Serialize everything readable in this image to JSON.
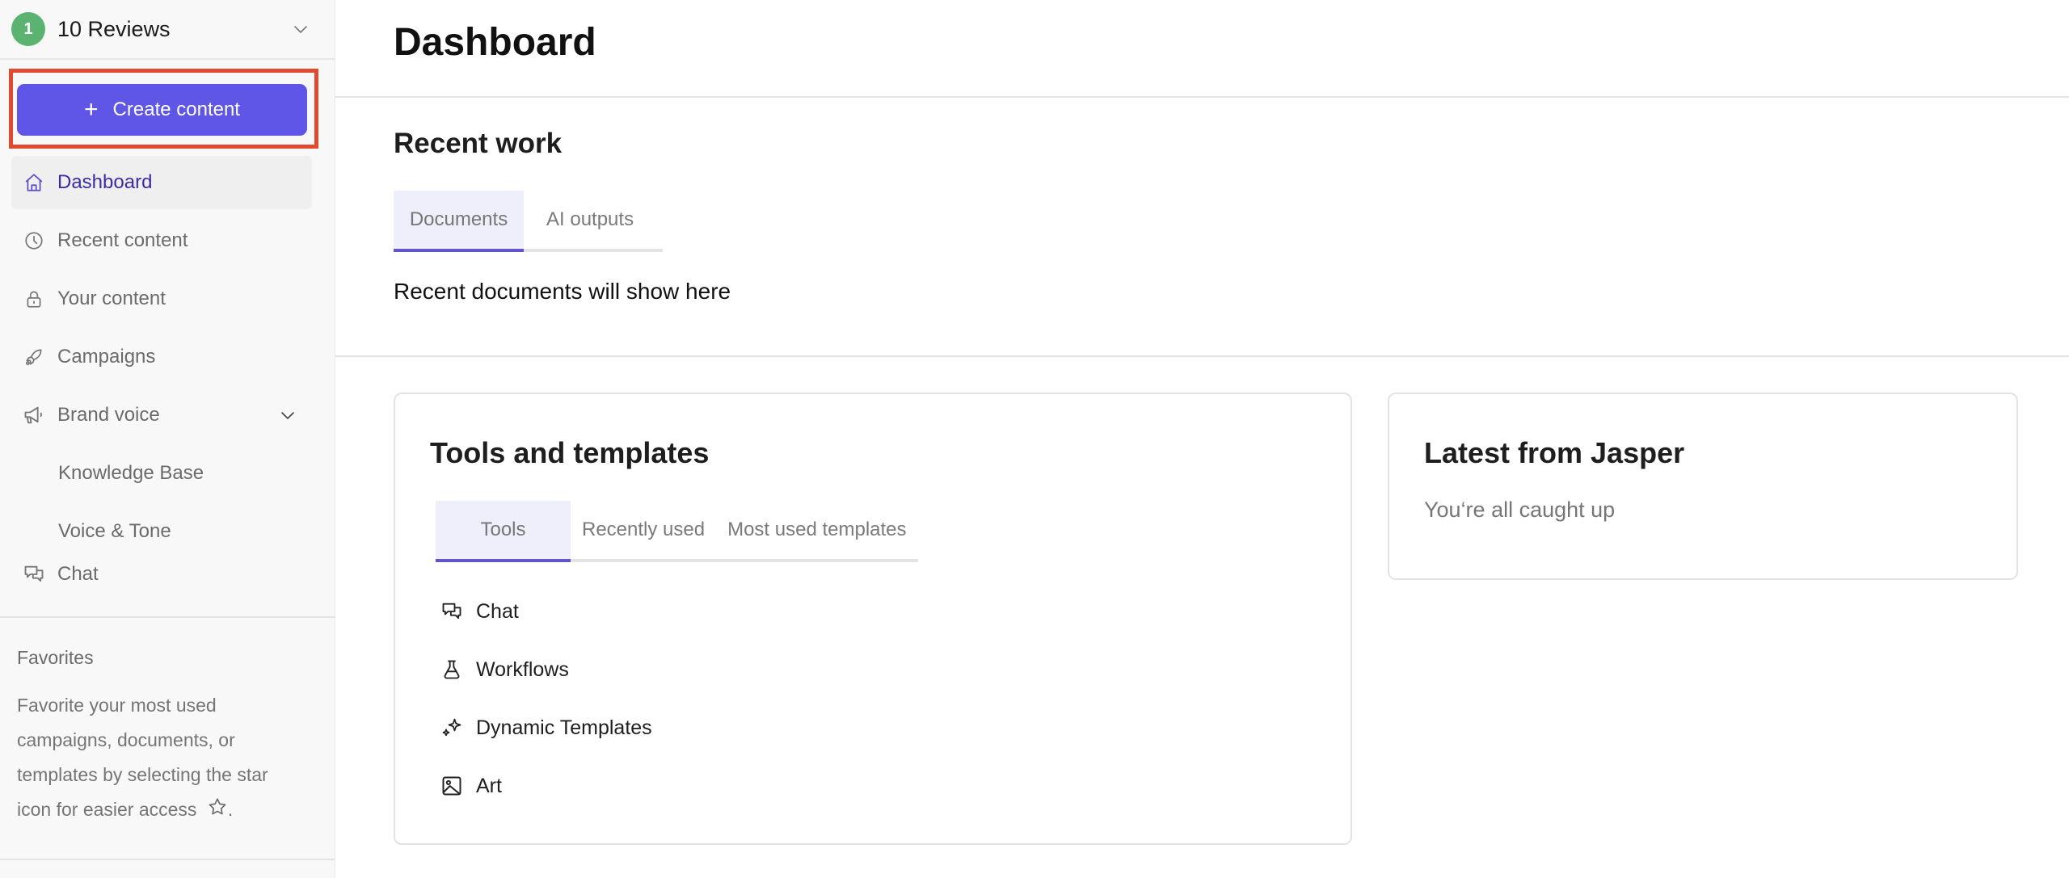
{
  "workspace": {
    "badge": "1",
    "name": "10 Reviews",
    "badge_color": "#5cb271"
  },
  "sidebar": {
    "create_button": {
      "label": "Create content",
      "icon": "plus-icon",
      "color": "#5f55e6"
    },
    "items": [
      {
        "label": "Dashboard",
        "icon": "home-icon",
        "active": true
      },
      {
        "label": "Recent content",
        "icon": "clock-icon"
      },
      {
        "label": "Your content",
        "icon": "lock-icon"
      },
      {
        "label": "Campaigns",
        "icon": "rocket-icon"
      },
      {
        "label": "Brand voice",
        "icon": "megaphone-icon",
        "expandable": true,
        "expanded": true
      },
      {
        "label": "Knowledge Base",
        "sub": true
      },
      {
        "label": "Voice & Tone",
        "sub": true
      },
      {
        "label": "Chat",
        "icon": "chat-icon"
      }
    ],
    "favorites": {
      "title": "Favorites",
      "text": "Favorite your most used campaigns, documents, or templates by selecting the star icon for easier access",
      "suffix": "."
    }
  },
  "main": {
    "title": "Dashboard",
    "recent_work": {
      "title": "Recent work",
      "tabs": [
        {
          "label": "Documents",
          "active": true
        },
        {
          "label": "AI outputs",
          "active": false
        }
      ],
      "empty_message": "Recent documents will show here"
    },
    "tools_templates": {
      "title": "Tools and templates",
      "tabs": [
        {
          "label": "Tools",
          "active": true
        },
        {
          "label": "Recently used",
          "active": false
        },
        {
          "label": "Most used templates",
          "active": false
        }
      ],
      "tools": [
        {
          "label": "Chat",
          "icon": "chat-icon"
        },
        {
          "label": "Workflows",
          "icon": "flask-icon"
        },
        {
          "label": "Dynamic Templates",
          "icon": "sparkles-icon"
        },
        {
          "label": "Art",
          "icon": "image-icon"
        }
      ]
    },
    "latest": {
      "title": "Latest from Jasper",
      "message": "You‘re all caught up"
    }
  },
  "colors": {
    "accent": "#5f55e6",
    "active_nav_text": "#3a2ca8",
    "highlight_border": "#e04a2f",
    "tab_active_bg": "#efeffb"
  }
}
